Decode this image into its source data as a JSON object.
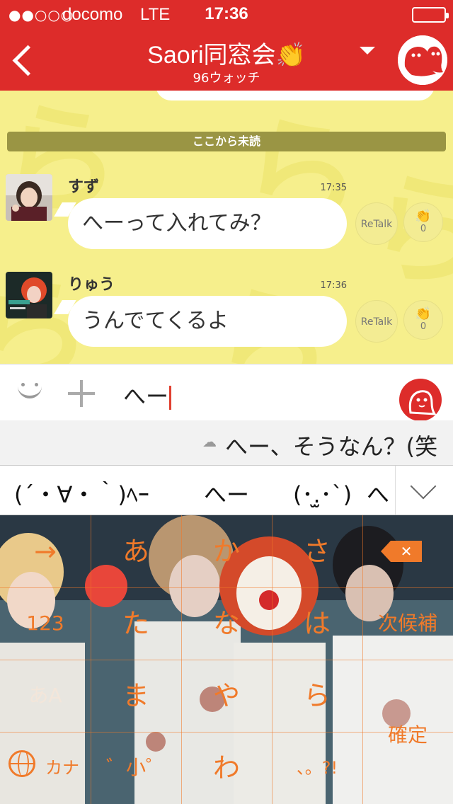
{
  "status_bar": {
    "signal": "●●○○○",
    "carrier": "docomo",
    "network": "LTE",
    "time": "17:36",
    "battery": "empty"
  },
  "header": {
    "title": "Saori同窓会👏",
    "subtitle": "96ウォッチ",
    "back_icon": "chevron-left-icon",
    "dropdown_icon": "triangle-down-icon",
    "group_icon": "ghost-avatar-icon",
    "accent_color": "#dd2c2a"
  },
  "chat": {
    "background_color": "#f6ef8c",
    "unread_label": "ここから未読",
    "messages": [
      {
        "name": "すず",
        "time": "17:35",
        "text": "へーって入れてみ？",
        "retalk_label": "ReTalk",
        "clap_count": "0"
      },
      {
        "name": "りゅう",
        "time": "17:36",
        "text": "うんでてくるよ",
        "retalk_label": "ReTalk",
        "clap_count": "0"
      }
    ]
  },
  "input_bar": {
    "emoji_icon": "smiley-icon",
    "plus_icon": "plus-icon",
    "value": "へー",
    "send_icon": "character-face-icon"
  },
  "keyboard": {
    "suggestion": "へー、そうなん？(笑",
    "candidates": [
      "(´・∀・｀)ﾍｰ",
      "へー",
      "(･.̫･`)",
      "へ"
    ],
    "keys": {
      "row1": [
        "→",
        "あ",
        "か",
        "さ"
      ],
      "row2": [
        "123",
        "た",
        "な",
        "は",
        "次候補"
      ],
      "row3": [
        "あA",
        "ま",
        "や",
        "ら"
      ],
      "row4": [
        "カナ",
        "゛小゜",
        "わ",
        "、。?!"
      ],
      "confirm": "確定"
    },
    "key_color": "#f07a2a"
  }
}
